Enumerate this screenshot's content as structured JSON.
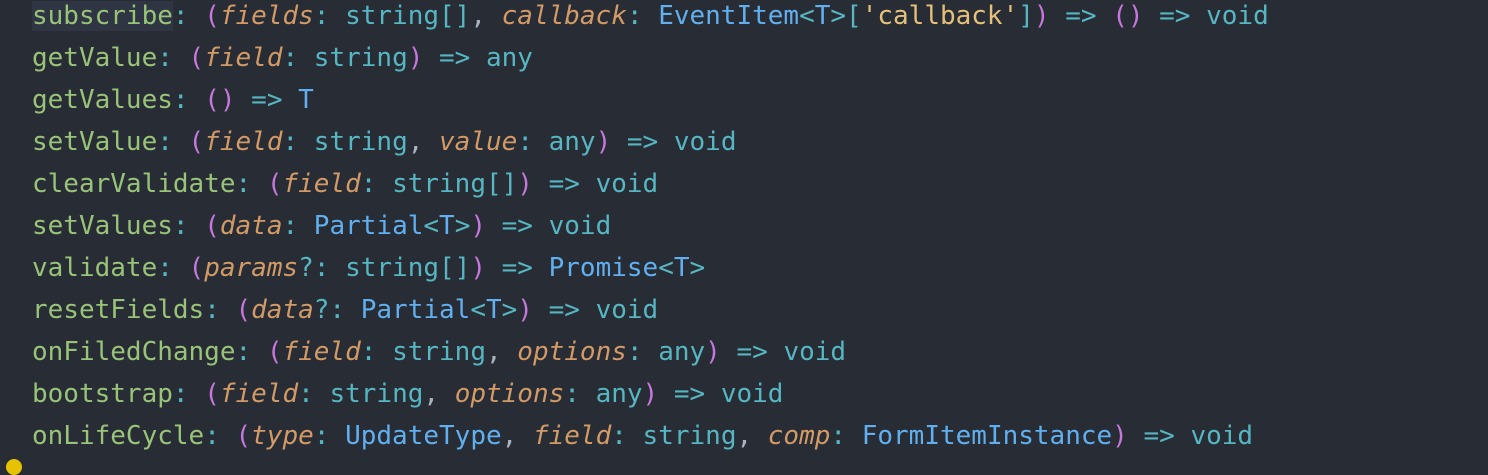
{
  "editor": {
    "lines": [
      [
        {
          "t": "subscribe",
          "c": "prop"
        },
        {
          "t": ": ",
          "c": "punc"
        },
        {
          "t": "(",
          "c": "paren"
        },
        {
          "t": "fields",
          "c": "param"
        },
        {
          "t": ": ",
          "c": "punc"
        },
        {
          "t": "string[]",
          "c": "type"
        },
        {
          "t": ", ",
          "c": "plain"
        },
        {
          "t": "callback",
          "c": "param"
        },
        {
          "t": ": ",
          "c": "punc"
        },
        {
          "t": "EventItem",
          "c": "class"
        },
        {
          "t": "<",
          "c": "punc"
        },
        {
          "t": "T",
          "c": "class"
        },
        {
          "t": ">[",
          "c": "punc"
        },
        {
          "t": "'callback'",
          "c": "str"
        },
        {
          "t": "]",
          "c": "punc"
        },
        {
          "t": ")",
          "c": "paren"
        },
        {
          "t": " => ",
          "c": "arrow"
        },
        {
          "t": "()",
          "c": "paren"
        },
        {
          "t": " => ",
          "c": "arrow"
        },
        {
          "t": "void",
          "c": "type"
        }
      ],
      [
        {
          "t": "getValue",
          "c": "prop"
        },
        {
          "t": ": ",
          "c": "punc"
        },
        {
          "t": "(",
          "c": "paren"
        },
        {
          "t": "field",
          "c": "param"
        },
        {
          "t": ": ",
          "c": "punc"
        },
        {
          "t": "string",
          "c": "type"
        },
        {
          "t": ")",
          "c": "paren"
        },
        {
          "t": " => ",
          "c": "arrow"
        },
        {
          "t": "any",
          "c": "type"
        }
      ],
      [
        {
          "t": "getValues",
          "c": "prop"
        },
        {
          "t": ": ",
          "c": "punc"
        },
        {
          "t": "()",
          "c": "paren"
        },
        {
          "t": " => ",
          "c": "arrow"
        },
        {
          "t": "T",
          "c": "class"
        }
      ],
      [
        {
          "t": "setValue",
          "c": "prop"
        },
        {
          "t": ": ",
          "c": "punc"
        },
        {
          "t": "(",
          "c": "paren"
        },
        {
          "t": "field",
          "c": "param"
        },
        {
          "t": ": ",
          "c": "punc"
        },
        {
          "t": "string",
          "c": "type"
        },
        {
          "t": ", ",
          "c": "plain"
        },
        {
          "t": "value",
          "c": "param"
        },
        {
          "t": ": ",
          "c": "punc"
        },
        {
          "t": "any",
          "c": "type"
        },
        {
          "t": ")",
          "c": "paren"
        },
        {
          "t": " => ",
          "c": "arrow"
        },
        {
          "t": "void",
          "c": "type"
        }
      ],
      [
        {
          "t": "clearValidate",
          "c": "prop"
        },
        {
          "t": ": ",
          "c": "punc"
        },
        {
          "t": "(",
          "c": "paren"
        },
        {
          "t": "field",
          "c": "param"
        },
        {
          "t": ": ",
          "c": "punc"
        },
        {
          "t": "string[]",
          "c": "type"
        },
        {
          "t": ")",
          "c": "paren"
        },
        {
          "t": " => ",
          "c": "arrow"
        },
        {
          "t": "void",
          "c": "type"
        }
      ],
      [
        {
          "t": "setValues",
          "c": "prop"
        },
        {
          "t": ": ",
          "c": "punc"
        },
        {
          "t": "(",
          "c": "paren"
        },
        {
          "t": "data",
          "c": "param"
        },
        {
          "t": ": ",
          "c": "punc"
        },
        {
          "t": "Partial",
          "c": "class"
        },
        {
          "t": "<",
          "c": "punc"
        },
        {
          "t": "T",
          "c": "class"
        },
        {
          "t": ">",
          "c": "punc"
        },
        {
          "t": ")",
          "c": "paren"
        },
        {
          "t": " => ",
          "c": "arrow"
        },
        {
          "t": "void",
          "c": "type"
        }
      ],
      [
        {
          "t": "validate",
          "c": "prop"
        },
        {
          "t": ": ",
          "c": "punc"
        },
        {
          "t": "(",
          "c": "paren"
        },
        {
          "t": "params",
          "c": "param"
        },
        {
          "t": "?: ",
          "c": "punc"
        },
        {
          "t": "string[]",
          "c": "type"
        },
        {
          "t": ")",
          "c": "paren"
        },
        {
          "t": " => ",
          "c": "arrow"
        },
        {
          "t": "Promise",
          "c": "class"
        },
        {
          "t": "<",
          "c": "punc"
        },
        {
          "t": "T",
          "c": "class"
        },
        {
          "t": ">",
          "c": "punc"
        }
      ],
      [
        {
          "t": "resetFields",
          "c": "prop"
        },
        {
          "t": ": ",
          "c": "punc"
        },
        {
          "t": "(",
          "c": "paren"
        },
        {
          "t": "data",
          "c": "param"
        },
        {
          "t": "?: ",
          "c": "punc"
        },
        {
          "t": "Partial",
          "c": "class"
        },
        {
          "t": "<",
          "c": "punc"
        },
        {
          "t": "T",
          "c": "class"
        },
        {
          "t": ">",
          "c": "punc"
        },
        {
          "t": ")",
          "c": "paren"
        },
        {
          "t": " => ",
          "c": "arrow"
        },
        {
          "t": "void",
          "c": "type"
        }
      ],
      [
        {
          "t": "onFiledChange",
          "c": "prop"
        },
        {
          "t": ": ",
          "c": "punc"
        },
        {
          "t": "(",
          "c": "paren"
        },
        {
          "t": "field",
          "c": "param"
        },
        {
          "t": ": ",
          "c": "punc"
        },
        {
          "t": "string",
          "c": "type"
        },
        {
          "t": ", ",
          "c": "plain"
        },
        {
          "t": "options",
          "c": "param"
        },
        {
          "t": ": ",
          "c": "punc"
        },
        {
          "t": "any",
          "c": "type"
        },
        {
          "t": ")",
          "c": "paren"
        },
        {
          "t": " => ",
          "c": "arrow"
        },
        {
          "t": "void",
          "c": "type"
        }
      ],
      [
        {
          "t": "bootstrap",
          "c": "prop"
        },
        {
          "t": ": ",
          "c": "punc"
        },
        {
          "t": "(",
          "c": "paren"
        },
        {
          "t": "field",
          "c": "param"
        },
        {
          "t": ": ",
          "c": "punc"
        },
        {
          "t": "string",
          "c": "type"
        },
        {
          "t": ", ",
          "c": "plain"
        },
        {
          "t": "options",
          "c": "param"
        },
        {
          "t": ": ",
          "c": "punc"
        },
        {
          "t": "any",
          "c": "type"
        },
        {
          "t": ")",
          "c": "paren"
        },
        {
          "t": " => ",
          "c": "arrow"
        },
        {
          "t": "void",
          "c": "type"
        }
      ],
      [
        {
          "t": "onLifeCycle",
          "c": "prop"
        },
        {
          "t": ": ",
          "c": "punc"
        },
        {
          "t": "(",
          "c": "paren"
        },
        {
          "t": "type",
          "c": "param"
        },
        {
          "t": ": ",
          "c": "punc"
        },
        {
          "t": "UpdateType",
          "c": "class"
        },
        {
          "t": ", ",
          "c": "plain"
        },
        {
          "t": "field",
          "c": "param"
        },
        {
          "t": ": ",
          "c": "punc"
        },
        {
          "t": "string",
          "c": "type"
        },
        {
          "t": ", ",
          "c": "plain"
        },
        {
          "t": "comp",
          "c": "param"
        },
        {
          "t": ": ",
          "c": "punc"
        },
        {
          "t": "FormItemInstance",
          "c": "class"
        },
        {
          "t": ")",
          "c": "paren"
        },
        {
          "t": " => ",
          "c": "arrow"
        },
        {
          "t": "void",
          "c": "type"
        }
      ]
    ]
  },
  "colors": {
    "background": "#282c34",
    "property": "#98c379",
    "punctuation": "#56b6c2",
    "paren": "#c678dd",
    "parameter": "#d19a66",
    "type": "#56b6c2",
    "class": "#61afef",
    "string": "#e5c07b",
    "gutter_marker": "#e6c200"
  }
}
